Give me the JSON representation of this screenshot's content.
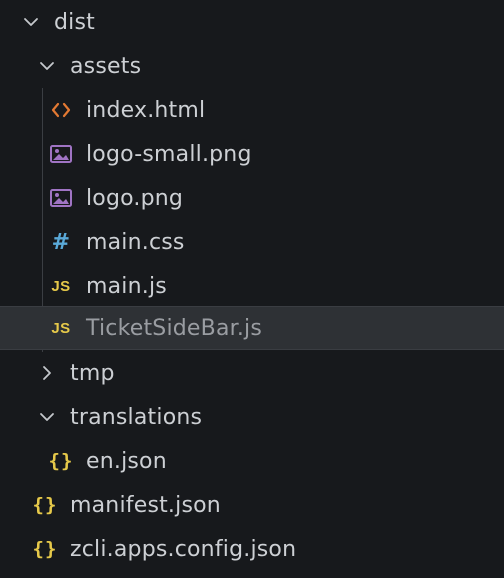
{
  "explorer": {
    "items": [
      {
        "label": "dist",
        "kind": "folder",
        "state": "expanded",
        "icon": "chevron-down-icon"
      },
      {
        "label": "assets",
        "kind": "folder",
        "state": "expanded",
        "icon": "chevron-down-icon"
      },
      {
        "label": "index.html",
        "kind": "file",
        "icon": "html-file-icon"
      },
      {
        "label": "logo-small.png",
        "kind": "file",
        "icon": "image-file-icon"
      },
      {
        "label": "logo.png",
        "kind": "file",
        "icon": "image-file-icon"
      },
      {
        "label": "main.css",
        "kind": "file",
        "icon": "css-file-icon",
        "icon_text": "#"
      },
      {
        "label": "main.js",
        "kind": "file",
        "icon": "js-file-icon",
        "icon_text": "JS"
      },
      {
        "label": "TicketSideBar.js",
        "kind": "file",
        "icon": "js-file-icon",
        "icon_text": "JS",
        "selected": true
      },
      {
        "label": "tmp",
        "kind": "folder",
        "state": "collapsed",
        "icon": "chevron-right-icon"
      },
      {
        "label": "translations",
        "kind": "folder",
        "state": "expanded",
        "icon": "chevron-down-icon"
      },
      {
        "label": "en.json",
        "kind": "file",
        "icon": "json-file-icon",
        "icon_text": "{}"
      },
      {
        "label": "manifest.json",
        "kind": "file",
        "icon": "json-file-icon",
        "icon_text": "{}"
      },
      {
        "label": "zcli.apps.config.json",
        "kind": "file",
        "icon": "json-file-icon",
        "icon_text": "{}"
      }
    ]
  },
  "colors": {
    "background": "#17191c",
    "selected_row": "#2e3135",
    "text": "#cdd0d4",
    "html_icon": "#e37933",
    "image_icon": "#a074c4",
    "css_icon": "#5aa9d8",
    "js_icon": "#e6c94a",
    "json_icon": "#e6c94a"
  }
}
